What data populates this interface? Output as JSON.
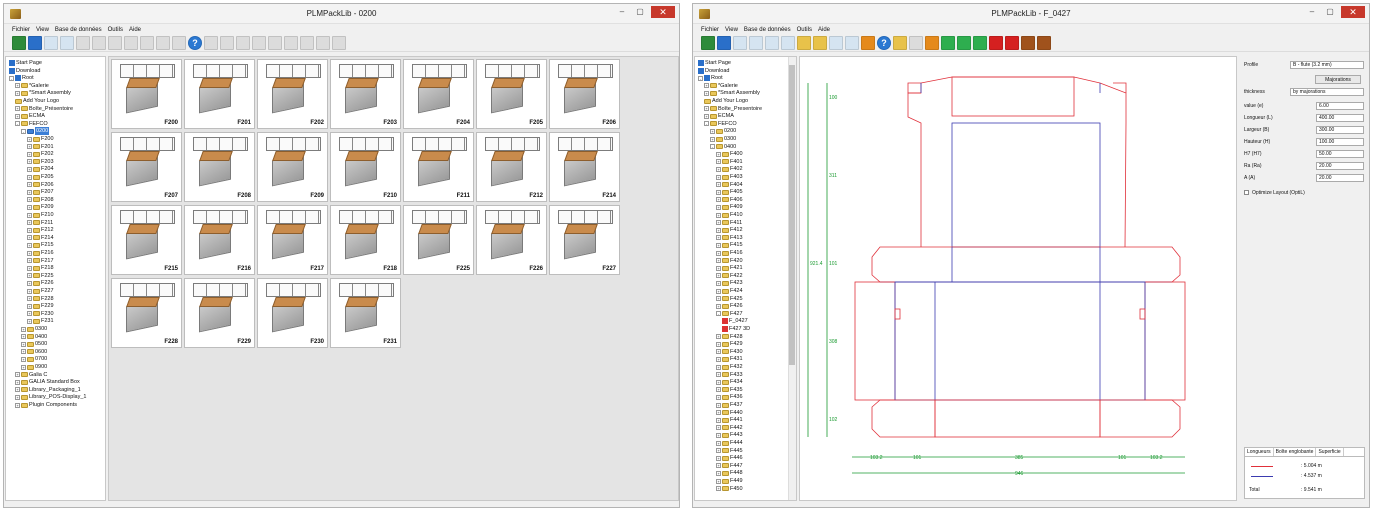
{
  "window_left": {
    "title": "PLMPackLib - 0200",
    "menu": [
      "Fichier",
      "View",
      "Base de données",
      "Outils",
      "Aide"
    ],
    "controls": {
      "minimize": "–",
      "maximize": "▢",
      "close": "✕"
    },
    "tree": [
      {
        "label": "Start Page",
        "lvl": 0,
        "kind": "icon"
      },
      {
        "label": "Download",
        "lvl": 0,
        "kind": "icon"
      },
      {
        "label": "Root",
        "lvl": 0,
        "kind": "icon",
        "pm": "-"
      },
      {
        "label": "*Galerie",
        "lvl": 1,
        "pm": "+"
      },
      {
        "label": "*Smart Assembly",
        "lvl": 1,
        "pm": "+"
      },
      {
        "label": "Add Your Logo",
        "lvl": 1
      },
      {
        "label": "Boîte_Présentoire",
        "lvl": 1,
        "pm": "+"
      },
      {
        "label": "ECMA",
        "lvl": 1,
        "pm": "+"
      },
      {
        "label": "FEFCO",
        "lvl": 1,
        "pm": "-"
      },
      {
        "label": "0200",
        "lvl": 2,
        "pm": "-",
        "sel": true
      },
      {
        "label": "F200",
        "lvl": 3,
        "pm": "+"
      },
      {
        "label": "F201",
        "lvl": 3,
        "pm": "+"
      },
      {
        "label": "F202",
        "lvl": 3,
        "pm": "+"
      },
      {
        "label": "F203",
        "lvl": 3,
        "pm": "+"
      },
      {
        "label": "F204",
        "lvl": 3,
        "pm": "+"
      },
      {
        "label": "F205",
        "lvl": 3,
        "pm": "+"
      },
      {
        "label": "F206",
        "lvl": 3,
        "pm": "+"
      },
      {
        "label": "F207",
        "lvl": 3,
        "pm": "+"
      },
      {
        "label": "F208",
        "lvl": 3,
        "pm": "+"
      },
      {
        "label": "F209",
        "lvl": 3,
        "pm": "+"
      },
      {
        "label": "F210",
        "lvl": 3,
        "pm": "+"
      },
      {
        "label": "F211",
        "lvl": 3,
        "pm": "+"
      },
      {
        "label": "F212",
        "lvl": 3,
        "pm": "+"
      },
      {
        "label": "F214",
        "lvl": 3,
        "pm": "+"
      },
      {
        "label": "F215",
        "lvl": 3,
        "pm": "+"
      },
      {
        "label": "F216",
        "lvl": 3,
        "pm": "+"
      },
      {
        "label": "F217",
        "lvl": 3,
        "pm": "+"
      },
      {
        "label": "F218",
        "lvl": 3,
        "pm": "+"
      },
      {
        "label": "F225",
        "lvl": 3,
        "pm": "+"
      },
      {
        "label": "F226",
        "lvl": 3,
        "pm": "+"
      },
      {
        "label": "F227",
        "lvl": 3,
        "pm": "+"
      },
      {
        "label": "F228",
        "lvl": 3,
        "pm": "+"
      },
      {
        "label": "F229",
        "lvl": 3,
        "pm": "+"
      },
      {
        "label": "F230",
        "lvl": 3,
        "pm": "+"
      },
      {
        "label": "F231",
        "lvl": 3,
        "pm": "+"
      },
      {
        "label": "0300",
        "lvl": 2,
        "pm": "+"
      },
      {
        "label": "0400",
        "lvl": 2,
        "pm": "+"
      },
      {
        "label": "0500",
        "lvl": 2,
        "pm": "+"
      },
      {
        "label": "0600",
        "lvl": 2,
        "pm": "+"
      },
      {
        "label": "0700",
        "lvl": 2,
        "pm": "+"
      },
      {
        "label": "0900",
        "lvl": 2,
        "pm": "+"
      },
      {
        "label": "Galia C",
        "lvl": 1,
        "pm": "+"
      },
      {
        "label": "GALIA Standard Box",
        "lvl": 1,
        "pm": "+"
      },
      {
        "label": "Library_Packaging_1",
        "lvl": 1,
        "pm": "+"
      },
      {
        "label": "Library_POS-Display_1",
        "lvl": 1,
        "pm": "+"
      },
      {
        "label": "Plugin Components",
        "lvl": 1,
        "pm": "+"
      }
    ],
    "thumbnails": [
      [
        "F200",
        "F201",
        "F202",
        "F203",
        "F204",
        "F205",
        "F206"
      ],
      [
        "F207",
        "F208",
        "F209",
        "F210",
        "F211",
        "F212",
        "F214"
      ],
      [
        "F215",
        "F216",
        "F217",
        "F218",
        "F225",
        "F226",
        "F227"
      ],
      [
        "F228",
        "F229",
        "F230",
        "F231"
      ]
    ]
  },
  "window_right": {
    "title": "PLMPackLib - F_0427",
    "menu": [
      "Fichier",
      "View",
      "Base de données",
      "Outils",
      "Aide"
    ],
    "controls": {
      "minimize": "–",
      "maximize": "▢",
      "close": "✕"
    },
    "tree": [
      {
        "label": "Start Page",
        "lvl": 0,
        "kind": "icon"
      },
      {
        "label": "Download",
        "lvl": 0,
        "kind": "icon"
      },
      {
        "label": "Root",
        "lvl": 0,
        "kind": "icon",
        "pm": "-"
      },
      {
        "label": "*Galerie",
        "lvl": 1,
        "pm": "+"
      },
      {
        "label": "*Smart Assembly",
        "lvl": 1,
        "pm": "+"
      },
      {
        "label": "Add Your Logo",
        "lvl": 1
      },
      {
        "label": "Boîte_Presentoire",
        "lvl": 1,
        "pm": "+"
      },
      {
        "label": "ECMA",
        "lvl": 1,
        "pm": "+"
      },
      {
        "label": "FEFCO",
        "lvl": 1,
        "pm": "-"
      },
      {
        "label": "0200",
        "lvl": 2,
        "pm": "+"
      },
      {
        "label": "0300",
        "lvl": 2,
        "pm": "+"
      },
      {
        "label": "0400",
        "lvl": 2,
        "pm": "-"
      },
      {
        "label": "F400",
        "lvl": 3,
        "pm": "+"
      },
      {
        "label": "F401",
        "lvl": 3,
        "pm": "+"
      },
      {
        "label": "F402",
        "lvl": 3,
        "pm": "+"
      },
      {
        "label": "F403",
        "lvl": 3,
        "pm": "+"
      },
      {
        "label": "F404",
        "lvl": 3,
        "pm": "+"
      },
      {
        "label": "F405",
        "lvl": 3,
        "pm": "+"
      },
      {
        "label": "F406",
        "lvl": 3,
        "pm": "+"
      },
      {
        "label": "F409",
        "lvl": 3,
        "pm": "+"
      },
      {
        "label": "F410",
        "lvl": 3,
        "pm": "+"
      },
      {
        "label": "F411",
        "lvl": 3,
        "pm": "+"
      },
      {
        "label": "F412",
        "lvl": 3,
        "pm": "+"
      },
      {
        "label": "F413",
        "lvl": 3,
        "pm": "+"
      },
      {
        "label": "F415",
        "lvl": 3,
        "pm": "+"
      },
      {
        "label": "F416",
        "lvl": 3,
        "pm": "+"
      },
      {
        "label": "F420",
        "lvl": 3,
        "pm": "+"
      },
      {
        "label": "F421",
        "lvl": 3,
        "pm": "+"
      },
      {
        "label": "F422",
        "lvl": 3,
        "pm": "+"
      },
      {
        "label": "F423",
        "lvl": 3,
        "pm": "+"
      },
      {
        "label": "F424",
        "lvl": 3,
        "pm": "+"
      },
      {
        "label": "F425",
        "lvl": 3,
        "pm": "+"
      },
      {
        "label": "F426",
        "lvl": 3,
        "pm": "+"
      },
      {
        "label": "F427",
        "lvl": 3,
        "pm": "-"
      },
      {
        "label": "F_0427",
        "lvl": 4,
        "kind": "doc"
      },
      {
        "label": "F427 3D",
        "lvl": 4,
        "kind": "doc"
      },
      {
        "label": "F428",
        "lvl": 3,
        "pm": "+"
      },
      {
        "label": "F429",
        "lvl": 3,
        "pm": "+"
      },
      {
        "label": "F430",
        "lvl": 3,
        "pm": "+"
      },
      {
        "label": "F431",
        "lvl": 3,
        "pm": "+"
      },
      {
        "label": "F432",
        "lvl": 3,
        "pm": "+"
      },
      {
        "label": "F433",
        "lvl": 3,
        "pm": "+"
      },
      {
        "label": "F434",
        "lvl": 3,
        "pm": "+"
      },
      {
        "label": "F435",
        "lvl": 3,
        "pm": "+"
      },
      {
        "label": "F436",
        "lvl": 3,
        "pm": "+"
      },
      {
        "label": "F437",
        "lvl": 3,
        "pm": "+"
      },
      {
        "label": "F440",
        "lvl": 3,
        "pm": "+"
      },
      {
        "label": "F441",
        "lvl": 3,
        "pm": "+"
      },
      {
        "label": "F442",
        "lvl": 3,
        "pm": "+"
      },
      {
        "label": "F443",
        "lvl": 3,
        "pm": "+"
      },
      {
        "label": "F444",
        "lvl": 3,
        "pm": "+"
      },
      {
        "label": "F445",
        "lvl": 3,
        "pm": "+"
      },
      {
        "label": "F446",
        "lvl": 3,
        "pm": "+"
      },
      {
        "label": "F447",
        "lvl": 3,
        "pm": "+"
      },
      {
        "label": "F448",
        "lvl": 3,
        "pm": "+"
      },
      {
        "label": "F449",
        "lvl": 3,
        "pm": "+"
      },
      {
        "label": "F450",
        "lvl": 3,
        "pm": "+"
      }
    ],
    "drawing": {
      "left_dims": [
        "100",
        "311",
        "101",
        "921.4",
        "308",
        "102"
      ],
      "bottom_dims": [
        "103.2",
        "101",
        "385",
        "101",
        "103.2",
        "946"
      ]
    },
    "properties": {
      "profile_label": "Profile",
      "profile_value": "B - flute (3.2 mm)",
      "majorations_button": "Majorations",
      "thickness_label": "thickness",
      "thickness_value": "by majorations",
      "params": [
        {
          "label": "value (e)",
          "value": "6.00"
        },
        {
          "label": "Longueur (L)",
          "value": "400.00"
        },
        {
          "label": "Largeur (B)",
          "value": "300.00"
        },
        {
          "label": "Hauteur (H)",
          "value": "100.00"
        },
        {
          "label": "H7 (H7)",
          "value": "50.00"
        },
        {
          "label": "Ra (Ra)",
          "value": "20.00"
        },
        {
          "label": "A (A)",
          "value": "20.00"
        }
      ],
      "optimize_label": "Optimize Layout (OptiL)"
    },
    "legend": {
      "tabs": [
        "Longueurs",
        "Boîte englobante",
        "Superficie"
      ],
      "rows": [
        {
          "color": "#e0303a",
          "value": ": 5.004 m"
        },
        {
          "color": "#3b3bb0",
          "value": ": 4.537 m"
        }
      ],
      "total_label": "Total",
      "total_value": ": 9.541 m"
    }
  }
}
